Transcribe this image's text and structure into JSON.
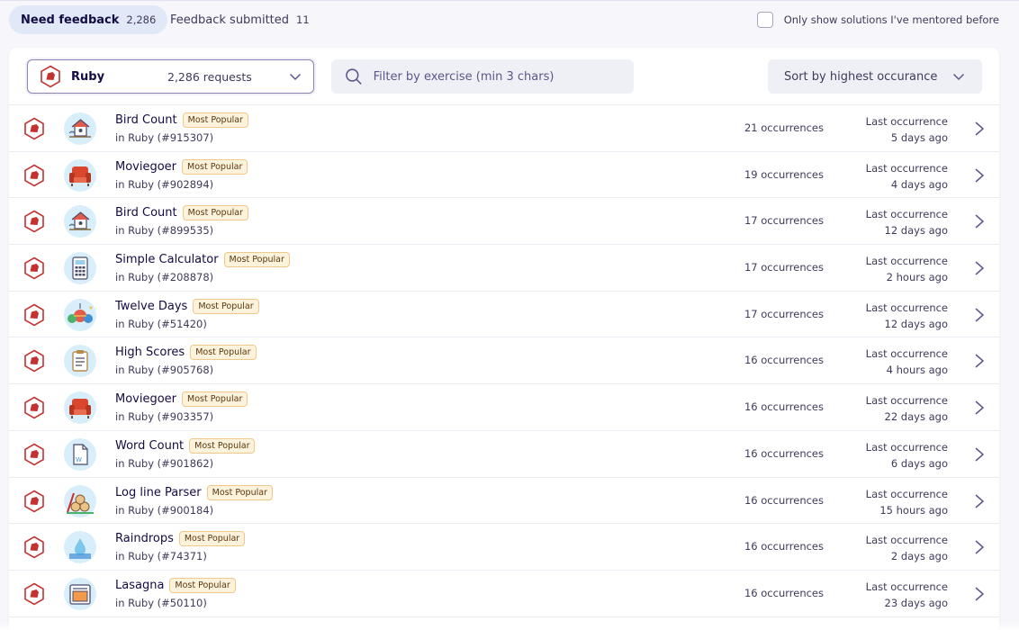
{
  "tabs": {
    "need_feedback": {
      "label": "Need feedback",
      "count": "2,286"
    },
    "submitted": {
      "label": "Feedback submitted",
      "count": "11"
    }
  },
  "mentored_label": "Only show solutions I've mentored before",
  "track_select": {
    "name": "Ruby",
    "requests": "2,286 requests"
  },
  "search": {
    "placeholder": "Filter by exercise (min 3 chars)"
  },
  "sort": {
    "label": "Sort by highest occurance"
  },
  "rows": [
    {
      "title": "Bird Count",
      "badge": "Most Popular",
      "sub": "in Ruby (#915307)",
      "occ": "21 occurrences",
      "last_label": "Last occurrence",
      "last_time": "5 days ago",
      "icon": "birdhouse-icon"
    },
    {
      "title": "Moviegoer",
      "badge": "Most Popular",
      "sub": "in Ruby (#902894)",
      "occ": "19 occurrences",
      "last_label": "Last occurrence",
      "last_time": "4 days ago",
      "icon": "armchair-icon"
    },
    {
      "title": "Bird Count",
      "badge": "Most Popular",
      "sub": "in Ruby (#899535)",
      "occ": "17 occurrences",
      "last_label": "Last occurrence",
      "last_time": "12 days ago",
      "icon": "birdhouse-icon"
    },
    {
      "title": "Simple Calculator",
      "badge": "Most Popular",
      "sub": "in Ruby (#208878)",
      "occ": "17 occurrences",
      "last_label": "Last occurrence",
      "last_time": "2 hours ago",
      "icon": "calculator-icon"
    },
    {
      "title": "Twelve Days",
      "badge": "Most Popular",
      "sub": "in Ruby (#51420)",
      "occ": "17 occurrences",
      "last_label": "Last occurrence",
      "last_time": "12 days ago",
      "icon": "ornaments-icon"
    },
    {
      "title": "High Scores",
      "badge": "Most Popular",
      "sub": "in Ruby (#905768)",
      "occ": "16 occurrences",
      "last_label": "Last occurrence",
      "last_time": "4 hours ago",
      "icon": "clipboard-icon"
    },
    {
      "title": "Moviegoer",
      "badge": "Most Popular",
      "sub": "in Ruby (#903357)",
      "occ": "16 occurrences",
      "last_label": "Last occurrence",
      "last_time": "22 days ago",
      "icon": "armchair-icon"
    },
    {
      "title": "Word Count",
      "badge": "Most Popular",
      "sub": "in Ruby (#901862)",
      "occ": "16 occurrences",
      "last_label": "Last occurrence",
      "last_time": "6 days ago",
      "icon": "document-icon"
    },
    {
      "title": "Log line Parser",
      "badge": "Most Popular",
      "sub": "in Ruby (#900184)",
      "occ": "16 occurrences",
      "last_label": "Last occurrence",
      "last_time": "15 hours ago",
      "icon": "logs-icon"
    },
    {
      "title": "Raindrops",
      "badge": "Most Popular",
      "sub": "in Ruby (#74371)",
      "occ": "16 occurrences",
      "last_label": "Last occurrence",
      "last_time": "2 days ago",
      "icon": "raindrop-icon"
    },
    {
      "title": "Lasagna",
      "badge": "Most Popular",
      "sub": "in Ruby (#50110)",
      "occ": "16 occurrences",
      "last_label": "Last occurrence",
      "last_time": "23 days ago",
      "icon": "oven-icon"
    }
  ],
  "colors": {
    "ruby": "#c43131",
    "accent": "#130b43",
    "badge_bg": "#fdf2dc",
    "badge_border": "#f0c98a"
  }
}
